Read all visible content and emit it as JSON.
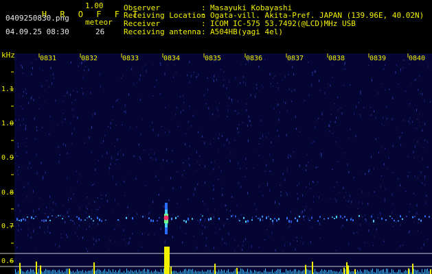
{
  "app": {
    "name": "H R O F F T",
    "version": "1.00"
  },
  "file": {
    "name": "0409250830.png",
    "datetime": "04.09.25 08:30"
  },
  "meteor": {
    "label": "meteor",
    "count": "26"
  },
  "info": [
    {
      "label": "Observer",
      "value": "Masayuki Kobayashi"
    },
    {
      "label": "Receiving Location",
      "value": "Ogata-vill. Akita-Pref. JAPAN (139.96E, 40.02N)"
    },
    {
      "label": "Receiver",
      "value": "ICOM IC-575 53.7492(@LCD)MHz USB"
    },
    {
      "label": "Receiving antenna",
      "value": "A504HB(yagi 4el)"
    }
  ],
  "axis": {
    "unit": "kHz",
    "time_labels": [
      "0831",
      "0832",
      "0833",
      "0834",
      "0835",
      "0836",
      "0837",
      "0838",
      "0839",
      "0840"
    ],
    "freq_labels": [
      "1.1",
      "1.0",
      "0.9",
      "0.8",
      "0.7",
      "0.6"
    ]
  },
  "colors": {
    "text": "#f2f200",
    "background": "#050533",
    "meteor": "#ff2a6a"
  }
}
